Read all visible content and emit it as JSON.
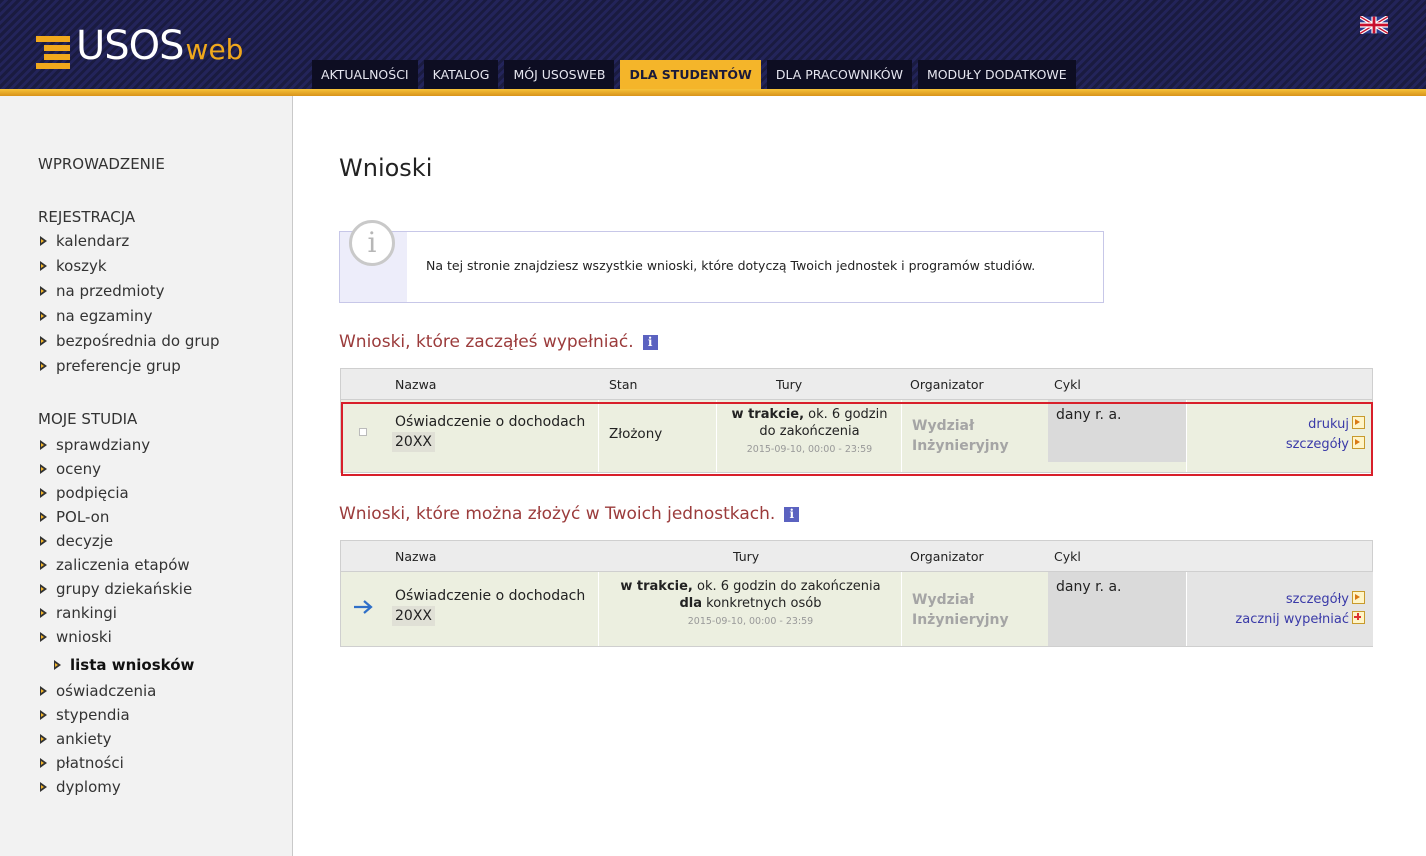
{
  "header": {
    "logo_main": "USOS",
    "logo_sub": "web",
    "tabs": [
      {
        "label": "AKTUALNOŚCI"
      },
      {
        "label": "KATALOG"
      },
      {
        "label": "MÓJ USOSWEB"
      },
      {
        "label": "DLA STUDENTÓW",
        "active": true
      },
      {
        "label": "DLA PRACOWNIKÓW"
      },
      {
        "label": "MODUŁY DODATKOWE"
      }
    ],
    "flag_icon": "uk-flag-icon"
  },
  "sidebar": {
    "sections": [
      {
        "heading": "WPROWADZENIE",
        "items": []
      },
      {
        "heading": "REJESTRACJA",
        "items": [
          "kalendarz",
          "koszyk",
          "na przedmioty",
          "na egzaminy",
          "bezpośrednia do grup",
          "preferencje grup"
        ]
      },
      {
        "heading": "MOJE STUDIA",
        "items": [
          "sprawdziany",
          "oceny",
          "podpięcia",
          "POL-on",
          "decyzje",
          "zaliczenia etapów",
          "grupy dziekańskie",
          "rankingi",
          "wnioski"
        ]
      }
    ],
    "sub_item": "lista wniosków",
    "after_items": [
      "oświadczenia",
      "stypendia",
      "ankiety",
      "płatności",
      "dyplomy"
    ]
  },
  "main": {
    "title": "Wnioski",
    "info_icon": "i",
    "info_text": "Na tej stronie znajdziesz wszystkie wnioski, które dotyczą Twoich jednostek i programów studiów.",
    "started": {
      "title": "Wnioski, które zacząłeś wypełniać.",
      "headers": {
        "name": "Nazwa",
        "status": "Stan",
        "rounds": "Tury",
        "organizer": "Organizator",
        "cycle": "Cykl"
      },
      "row": {
        "name": "Oświadczenie o dochodach",
        "year": "20XX",
        "status": "Złożony",
        "round_bold": "w trakcie,",
        "round_rest": " ok. 6 godzin",
        "round_line2": "do zakończenia",
        "round_date": "2015-09-10, 00:00 - 23:59",
        "organizer_line1": "Wydział",
        "organizer_line2": "Inżynieryjny",
        "cycle": "dany r. a.",
        "action1": "drukuj",
        "action2": "szczegóły"
      }
    },
    "available": {
      "title": "Wnioski, które można złożyć w Twoich jednostkach.",
      "headers": {
        "name": "Nazwa",
        "rounds": "Tury",
        "organizer": "Organizator",
        "cycle": "Cykl"
      },
      "row": {
        "name": "Oświadczenie o dochodach",
        "year": "20XX",
        "round_bold": "w trakcie,",
        "round_rest": " ok. 6 godzin do zakończenia",
        "round_bold2": "dla",
        "round_rest2": " konkretnych osób",
        "round_date": "2015-09-10, 00:00 - 23:59",
        "organizer_line1": "Wydział",
        "organizer_line2": "Inżynieryjny",
        "cycle": "dany r. a.",
        "action1": "szczegóły",
        "action2": "zacznij wypełniać"
      }
    }
  }
}
